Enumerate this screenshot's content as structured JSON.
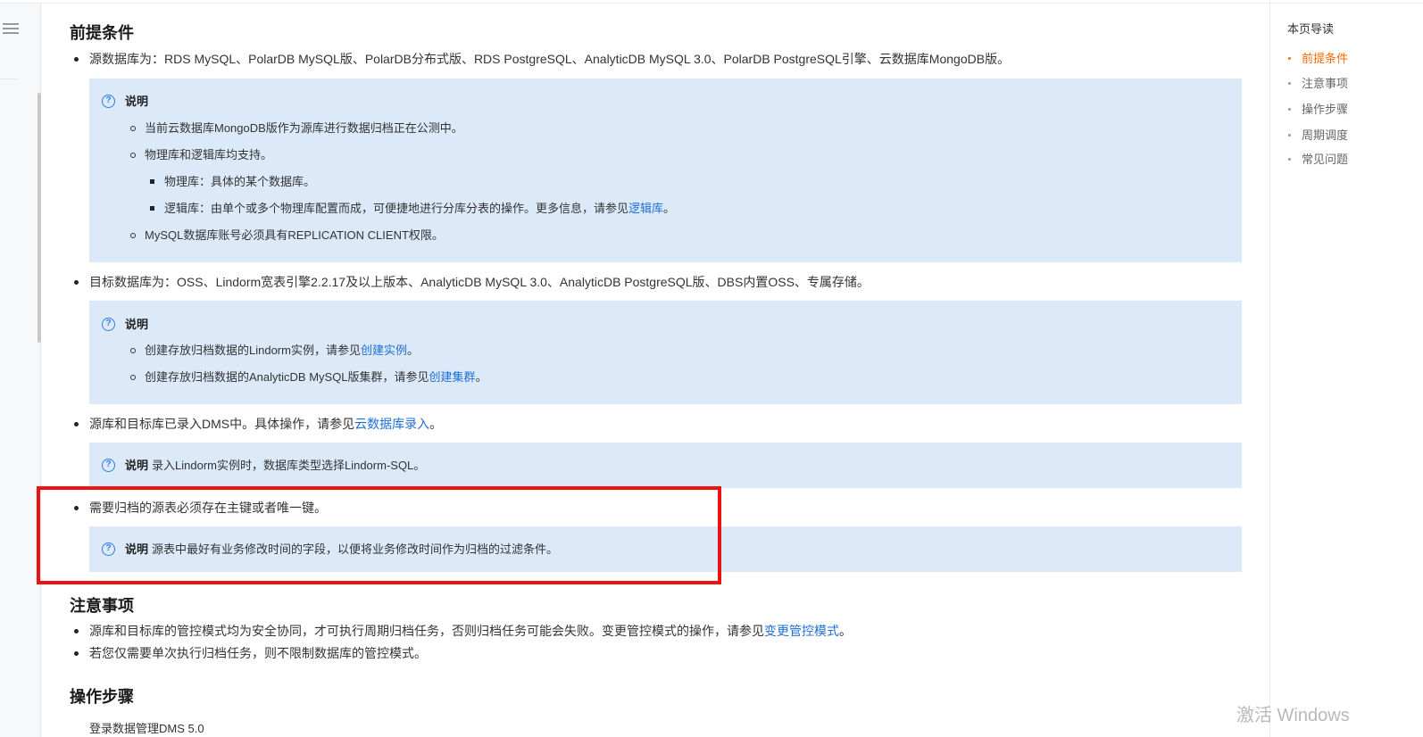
{
  "sections": {
    "prerequisites_title": "前提条件",
    "notes_title": "注意事项",
    "steps_title": "操作步骤"
  },
  "prereq": {
    "item1": "源数据库为：RDS MySQL、PolarDB MySQL版、PolarDB分布式版、RDS PostgreSQL、AnalyticDB MySQL 3.0、PolarDB PostgreSQL引擎、云数据库MongoDB版。",
    "note_label": "说明",
    "note1_a": "当前云数据库MongoDB版作为源库进行数据归档正在公测中。",
    "note1_b": "物理库和逻辑库均支持。",
    "note1_b1": "物理库：具体的某个数据库。",
    "note1_b2_prefix": "逻辑库：由单个或多个物理库配置而成，可便捷地进行分库分表的操作。更多信息，请参见",
    "note1_b2_link": "逻辑库",
    "note1_b2_suffix": "。",
    "note1_c": "MySQL数据库账号必须具有REPLICATION CLIENT权限。",
    "item2": "目标数据库为：OSS、Lindorm宽表引擎2.2.17及以上版本、AnalyticDB MySQL 3.0、AnalyticDB PostgreSQL版、DBS内置OSS、专属存储。",
    "note2_a_prefix": "创建存放归档数据的Lindorm实例，请参见",
    "note2_a_link": "创建实例",
    "note2_a_suffix": "。",
    "note2_b_prefix": "创建存放归档数据的AnalyticDB MySQL版集群，请参见",
    "note2_b_link": "创建集群",
    "note2_b_suffix": "。",
    "item3_prefix": "源库和目标库已录入DMS中。具体操作，请参见",
    "item3_link": "云数据库录入",
    "item3_suffix": "。",
    "note3": "录入Lindorm实例时，数据库类型选择Lindorm-SQL。",
    "item4": "需要归档的源表必须存在主键或者唯一键。",
    "note4": "源表中最好有业务修改时间的字段，以便将业务修改时间作为归档的过滤条件。"
  },
  "notes": {
    "item1_prefix": "源库和目标库的管控模式均为安全协同，才可执行周期归档任务，否则归档任务可能会失败。变更管控模式的操作，请参见",
    "item1_link": "变更管控模式",
    "item1_suffix": "。",
    "item2": "若您仅需要单次执行归档任务，则不限制数据库的管控模式。"
  },
  "steps": {
    "item1_partial": "登录数据管理DMS 5.0"
  },
  "toc": {
    "title": "本页导读",
    "items": [
      "前提条件",
      "注意事项",
      "操作步骤",
      "周期调度",
      "常见问题"
    ],
    "active_index": 0
  },
  "watermark": "激活 Windows",
  "colors": {
    "link": "#1f6fd6",
    "note_bg": "#dbe9f8",
    "toc_active": "#ff6a00",
    "highlight_box": "#ee1111"
  },
  "icons": {
    "menu": "hamburger-menu-icon",
    "note": "question-circle-icon"
  }
}
